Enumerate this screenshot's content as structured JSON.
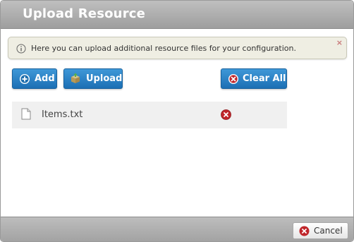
{
  "dialog": {
    "title": "Upload Resource"
  },
  "info": {
    "icon": "info-icon",
    "text": "Here you can upload additional resource files for your configuration.",
    "close_label": "×"
  },
  "toolbar": {
    "add_label": "Add",
    "add_icon": "plus-circle-icon",
    "upload_label": "Upload",
    "upload_icon": "upload-box-icon",
    "clear_label": "Clear All",
    "clear_icon": "remove-circle-icon"
  },
  "files": [
    {
      "name": "Items.txt",
      "icon": "file-icon",
      "remove_icon": "remove-icon"
    }
  ],
  "footer": {
    "cancel_label": "Cancel",
    "cancel_icon": "cancel-icon"
  },
  "colors": {
    "button_blue": "#2a7fc4",
    "titlebar_gray": "#a8a8a8",
    "info_background": "#efeee3",
    "remove_red": "#c0262b"
  }
}
